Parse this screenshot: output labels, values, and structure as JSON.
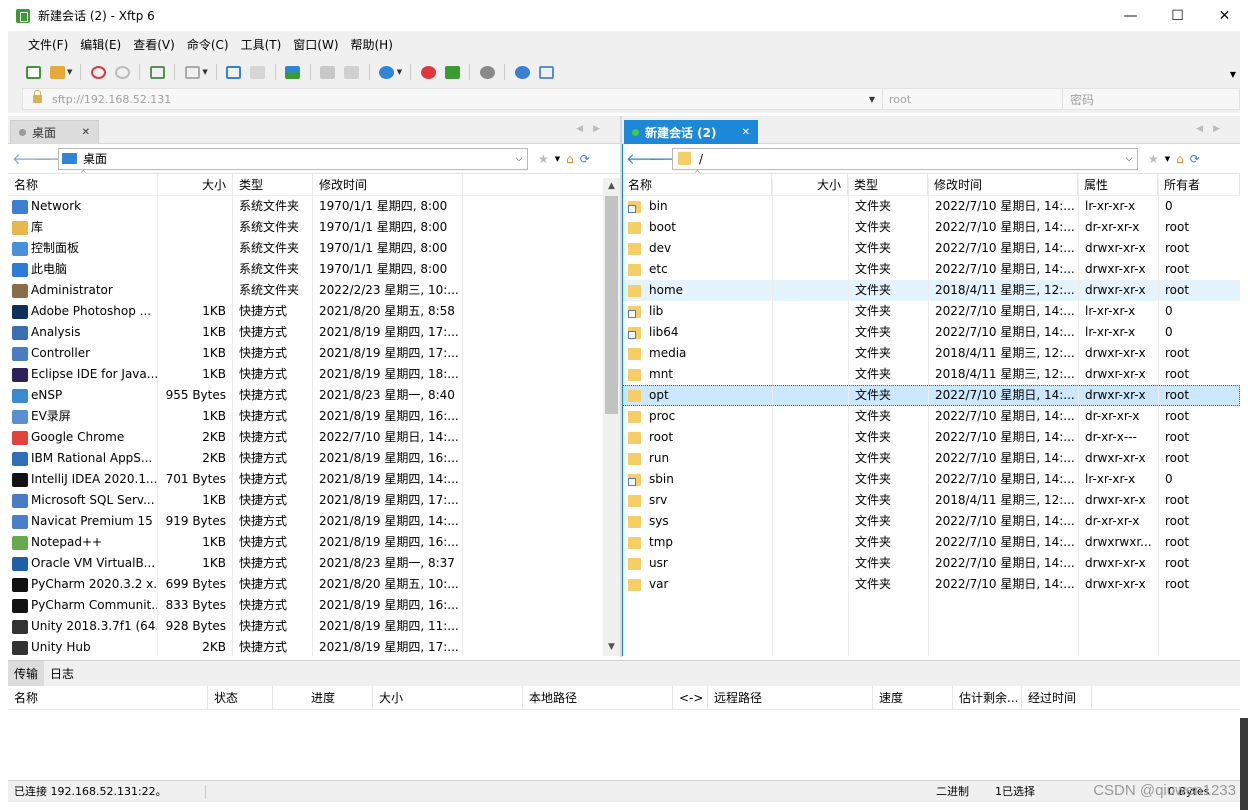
{
  "window": {
    "title": "新建会话 (2) - Xftp 6",
    "controls": [
      "—",
      "☐",
      "✕"
    ]
  },
  "menu": [
    "文件(F)",
    "编辑(E)",
    "查看(V)",
    "命令(C)",
    "工具(T)",
    "窗口(W)",
    "帮助(H)"
  ],
  "toolbar": {
    "icons": [
      "new-session-icon",
      "open-folder-icon",
      "disconnect-icon",
      "reconnect-icon",
      "session-properties-icon",
      "display-icon",
      "transfer-left-icon",
      "transfer-doc-icon",
      "sync-icon",
      "copy-icon",
      "paste-icon",
      "globe-icon",
      "xshell-icon",
      "xftp-icon",
      "settings-icon",
      "help-icon",
      "chat-icon"
    ],
    "colors": {
      "accent": "#1e88d8",
      "red": "#e0383a",
      "green": "#3c9a32",
      "blue": "#2f86d6"
    }
  },
  "address": {
    "url": "sftp://192.168.52.131",
    "user_placeholder": "root",
    "pass_placeholder": "密码"
  },
  "left": {
    "tab": "桌面",
    "path": "桌面",
    "columns": [
      "名称",
      "大小",
      "类型",
      "修改时间"
    ],
    "rows": [
      {
        "name": "Network",
        "size": "",
        "type": "系统文件夹",
        "date": "1970/1/1 星期四, 8:00",
        "icon": "#3d7fd0"
      },
      {
        "name": "库",
        "size": "",
        "type": "系统文件夹",
        "date": "1970/1/1 星期四, 8:00",
        "icon": "#e8b84a"
      },
      {
        "name": "控制面板",
        "size": "",
        "type": "系统文件夹",
        "date": "1970/1/1 星期四, 8:00",
        "icon": "#4a90d9"
      },
      {
        "name": "此电脑",
        "size": "",
        "type": "系统文件夹",
        "date": "1970/1/1 星期四, 8:00",
        "icon": "#2e7bd6"
      },
      {
        "name": "Administrator",
        "size": "",
        "type": "系统文件夹",
        "date": "2022/2/23 星期三, 10:...",
        "icon": "#8a6b4a"
      },
      {
        "name": "Adobe Photoshop ...",
        "size": "1KB",
        "type": "快捷方式",
        "date": "2021/8/20 星期五, 8:58",
        "icon": "#0f2f5a"
      },
      {
        "name": "Analysis",
        "size": "1KB",
        "type": "快捷方式",
        "date": "2021/8/19 星期四, 17:...",
        "icon": "#3b6fb5"
      },
      {
        "name": "Controller",
        "size": "1KB",
        "type": "快捷方式",
        "date": "2021/8/19 星期四, 17:...",
        "icon": "#4c7cc0"
      },
      {
        "name": "Eclipse IDE for Java...",
        "size": "1KB",
        "type": "快捷方式",
        "date": "2021/8/19 星期四, 18:...",
        "icon": "#2c2255"
      },
      {
        "name": "eNSP",
        "size": "955 Bytes",
        "type": "快捷方式",
        "date": "2021/8/23 星期一, 8:40",
        "icon": "#3a8ad0"
      },
      {
        "name": "EV录屏",
        "size": "1KB",
        "type": "快捷方式",
        "date": "2021/8/19 星期四, 16:...",
        "icon": "#5a8fd0"
      },
      {
        "name": "Google Chrome",
        "size": "2KB",
        "type": "快捷方式",
        "date": "2022/7/10 星期日, 14:...",
        "icon": "#e0443a"
      },
      {
        "name": "IBM Rational AppS...",
        "size": "2KB",
        "type": "快捷方式",
        "date": "2021/8/19 星期四, 16:...",
        "icon": "#2f6fb8"
      },
      {
        "name": "IntelliJ IDEA 2020.1....",
        "size": "701 Bytes",
        "type": "快捷方式",
        "date": "2021/8/19 星期四, 14:...",
        "icon": "#111111"
      },
      {
        "name": "Microsoft SQL Serv...",
        "size": "1KB",
        "type": "快捷方式",
        "date": "2021/8/19 星期四, 17:...",
        "icon": "#4a7cc4"
      },
      {
        "name": "Navicat Premium 15",
        "size": "919 Bytes",
        "type": "快捷方式",
        "date": "2021/8/19 星期四, 14:...",
        "icon": "#4b80c8"
      },
      {
        "name": "Notepad++",
        "size": "1KB",
        "type": "快捷方式",
        "date": "2021/8/19 星期四, 16:...",
        "icon": "#6aa84f"
      },
      {
        "name": "Oracle VM VirtualB...",
        "size": "1KB",
        "type": "快捷方式",
        "date": "2021/8/23 星期一, 8:37",
        "icon": "#1f5fa8"
      },
      {
        "name": "PyCharm 2020.3.2 x...",
        "size": "699 Bytes",
        "type": "快捷方式",
        "date": "2021/8/20 星期五, 10:...",
        "icon": "#111111"
      },
      {
        "name": "PyCharm Communit...",
        "size": "833 Bytes",
        "type": "快捷方式",
        "date": "2021/8/19 星期四, 16:...",
        "icon": "#111111"
      },
      {
        "name": "Unity 2018.3.7f1 (64...",
        "size": "928 Bytes",
        "type": "快捷方式",
        "date": "2021/8/19 星期四, 11:...",
        "icon": "#333333"
      },
      {
        "name": "Unity Hub",
        "size": "2KB",
        "type": "快捷方式",
        "date": "2021/8/19 星期四, 17:...",
        "icon": "#333333"
      }
    ]
  },
  "right": {
    "tab": "新建会话 (2)",
    "path": "/",
    "columns": [
      "名称",
      "大小",
      "类型",
      "修改时间",
      "属性",
      "所有者"
    ],
    "rows": [
      {
        "name": "bin",
        "type": "文件夹",
        "date": "2022/7/10 星期日, 14:...",
        "attr": "lr-xr-xr-x",
        "owner": "0",
        "link": true
      },
      {
        "name": "boot",
        "type": "文件夹",
        "date": "2022/7/10 星期日, 14:...",
        "attr": "dr-xr-xr-x",
        "owner": "root",
        "link": false
      },
      {
        "name": "dev",
        "type": "文件夹",
        "date": "2022/7/10 星期日, 14:...",
        "attr": "drwxr-xr-x",
        "owner": "root",
        "link": false
      },
      {
        "name": "etc",
        "type": "文件夹",
        "date": "2022/7/10 星期日, 14:...",
        "attr": "drwxr-xr-x",
        "owner": "root",
        "link": false
      },
      {
        "name": "home",
        "type": "文件夹",
        "date": "2018/4/11 星期三, 12:...",
        "attr": "drwxr-xr-x",
        "owner": "root",
        "link": false
      },
      {
        "name": "lib",
        "type": "文件夹",
        "date": "2022/7/10 星期日, 14:...",
        "attr": "lr-xr-xr-x",
        "owner": "0",
        "link": true
      },
      {
        "name": "lib64",
        "type": "文件夹",
        "date": "2022/7/10 星期日, 14:...",
        "attr": "lr-xr-xr-x",
        "owner": "0",
        "link": true
      },
      {
        "name": "media",
        "type": "文件夹",
        "date": "2018/4/11 星期三, 12:...",
        "attr": "drwxr-xr-x",
        "owner": "root",
        "link": false
      },
      {
        "name": "mnt",
        "type": "文件夹",
        "date": "2018/4/11 星期三, 12:...",
        "attr": "drwxr-xr-x",
        "owner": "root",
        "link": false
      },
      {
        "name": "opt",
        "type": "文件夹",
        "date": "2022/7/10 星期日, 14:...",
        "attr": "drwxr-xr-x",
        "owner": "root",
        "link": false
      },
      {
        "name": "proc",
        "type": "文件夹",
        "date": "2022/7/10 星期日, 14:...",
        "attr": "dr-xr-xr-x",
        "owner": "root",
        "link": false
      },
      {
        "name": "root",
        "type": "文件夹",
        "date": "2022/7/10 星期日, 14:...",
        "attr": "dr-xr-x---",
        "owner": "root",
        "link": false
      },
      {
        "name": "run",
        "type": "文件夹",
        "date": "2022/7/10 星期日, 14:...",
        "attr": "drwxr-xr-x",
        "owner": "root",
        "link": false
      },
      {
        "name": "sbin",
        "type": "文件夹",
        "date": "2022/7/10 星期日, 14:...",
        "attr": "lr-xr-xr-x",
        "owner": "0",
        "link": true
      },
      {
        "name": "srv",
        "type": "文件夹",
        "date": "2018/4/11 星期三, 12:...",
        "attr": "drwxr-xr-x",
        "owner": "root",
        "link": false
      },
      {
        "name": "sys",
        "type": "文件夹",
        "date": "2022/7/10 星期日, 14:...",
        "attr": "dr-xr-xr-x",
        "owner": "root",
        "link": false
      },
      {
        "name": "tmp",
        "type": "文件夹",
        "date": "2022/7/10 星期日, 14:...",
        "attr": "drwxrwxr...",
        "owner": "root",
        "link": false
      },
      {
        "name": "usr",
        "type": "文件夹",
        "date": "2022/7/10 星期日, 14:...",
        "attr": "drwxr-xr-x",
        "owner": "root",
        "link": false
      },
      {
        "name": "var",
        "type": "文件夹",
        "date": "2022/7/10 星期日, 14:...",
        "attr": "drwxr-xr-x",
        "owner": "root",
        "link": false
      }
    ],
    "hover_row": "home",
    "selected_row": "opt"
  },
  "bottom": {
    "tabs": [
      "传输",
      "日志"
    ],
    "columns": [
      "名称",
      "状态",
      "进度",
      "大小",
      "本地路径",
      "<->",
      "远程路径",
      "速度",
      "估计剩余...",
      "经过时间"
    ]
  },
  "status": {
    "connection": "已连接 192.168.52.131:22。",
    "mode": "二进制",
    "selected": "1已选择",
    "bytes": "0 Bytes"
  },
  "watermark": "CSDN @qiuwen1233"
}
